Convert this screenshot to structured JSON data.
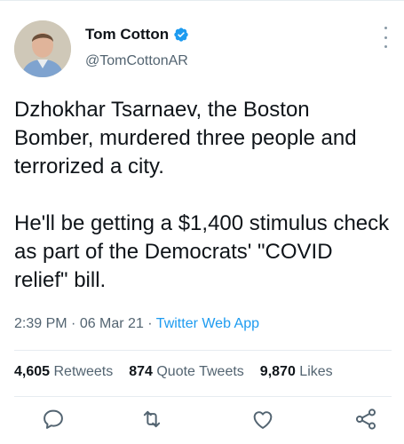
{
  "author": {
    "display_name": "Tom Cotton",
    "handle": "@TomCottonAR",
    "avatar_icon": "profile-photo",
    "verified_icon": "verified-badge-icon"
  },
  "tweet": {
    "paragraph1": "Dzhokhar Tsarnaev, the Boston Bomber, murdered three people and terrorized a city.",
    "paragraph2": "He'll be getting a $1,400 stimulus check as part of the Democrats' \"COVID relief\" bill."
  },
  "meta": {
    "time": "2:39 PM",
    "sep1": " · ",
    "date": "06 Mar 21",
    "sep2": " · ",
    "source": "Twitter Web App"
  },
  "stats": {
    "retweets_count": "4,605",
    "retweets_label": "Retweets",
    "quote_count": "874",
    "quote_label": "Quote Tweets",
    "likes_count": "9,870",
    "likes_label": "Likes"
  },
  "actions": [
    "reply-icon",
    "retweet-icon",
    "like-icon",
    "share-icon"
  ],
  "colors": {
    "accent": "#1d9bf0",
    "muted": "#536471",
    "text": "#0f1419",
    "divider": "#e6ecf0"
  }
}
